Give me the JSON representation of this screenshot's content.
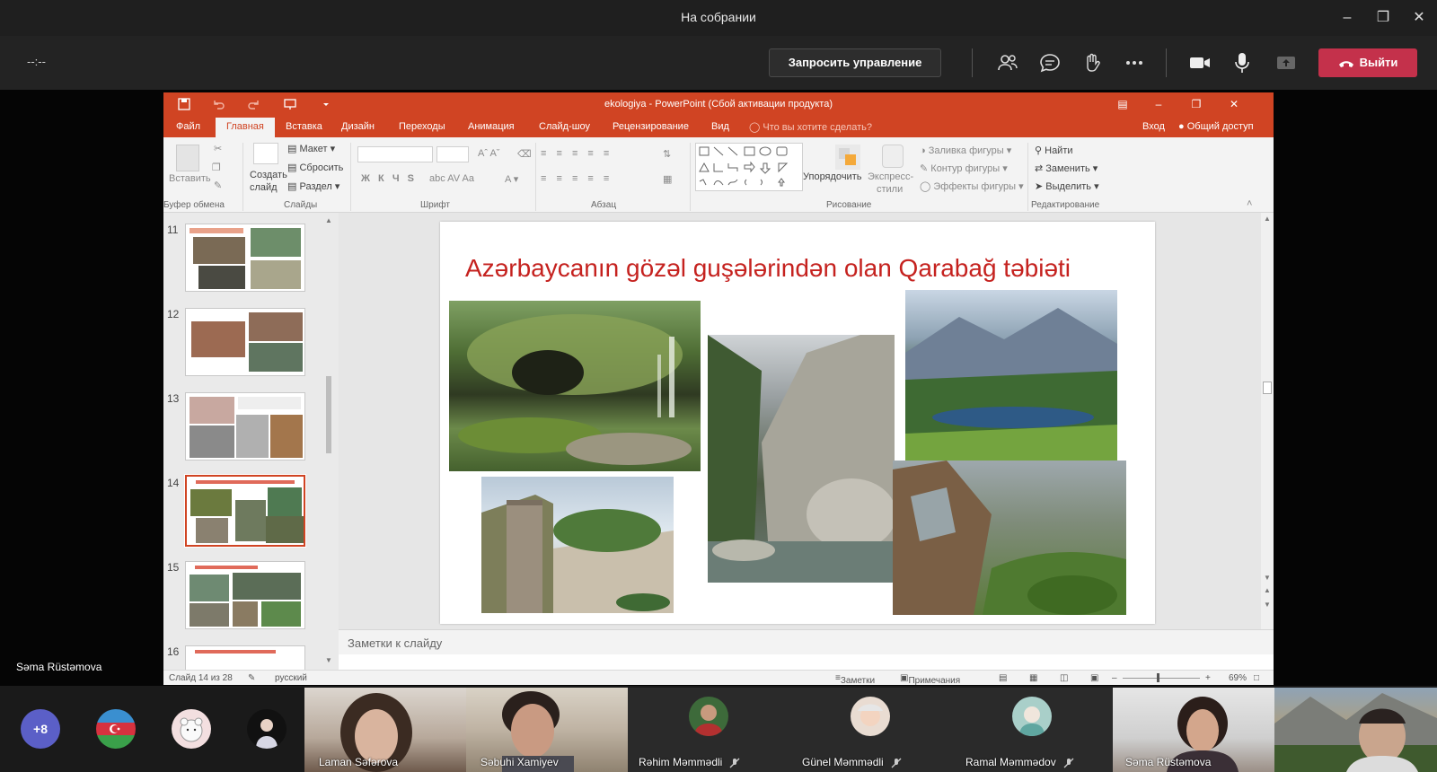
{
  "teams": {
    "window_title": "На собрании",
    "timer": "--:--",
    "request_control": "Запросить управление",
    "leave": "Выйти",
    "presenter_name": "Səma Rüstəmova"
  },
  "ppt": {
    "window_title": "ekologiya - PowerPoint (Сбой активации продукта)",
    "tabs": [
      "Файл",
      "Главная",
      "Вставка",
      "Дизайн",
      "Переходы",
      "Анимация",
      "Слайд-шоу",
      "Рецензирование",
      "Вид"
    ],
    "tell_me": "Что вы хотите сделать?",
    "sign_in": "Вход",
    "share": "Общий доступ",
    "ribbon": {
      "paste": "Вставить",
      "clipboard": "Буфер обмена",
      "new_slide_1": "Создать",
      "new_slide_2": "слайд",
      "layout": "Макет",
      "reset": "Сбросить",
      "section": "Раздел",
      "slides": "Слайды",
      "font": "Шрифт",
      "paragraph": "Абзац",
      "arrange": "Упорядочить",
      "quick_styles_1": "Экспресс-",
      "quick_styles_2": "стили",
      "shape_fill": "Заливка фигуры",
      "shape_outline": "Контур фигуры",
      "shape_effects": "Эффекты фигуры",
      "drawing": "Рисование",
      "find": "Найти",
      "replace": "Заменить",
      "select": "Выделить",
      "editing": "Редактирование"
    },
    "thumb_numbers": [
      "11",
      "12",
      "13",
      "14",
      "15",
      "16"
    ],
    "slide_title": "Azərbaycanın gözəl guşələrindən olan Qarabağ təbiəti",
    "notes_placeholder": "Заметки к слайду",
    "status": {
      "slide_info": "Слайд 14 из 28",
      "language": "русский",
      "notes": "Заметки",
      "comments": "Примечания",
      "zoom": "69%"
    }
  },
  "participants": {
    "more_count": "+8",
    "tiles": [
      {
        "name": "Laman Səfərova",
        "muted": false
      },
      {
        "name": "Səbuhi Xamiyev",
        "muted": false
      },
      {
        "name": "Rəhim Məmmədli",
        "muted": true
      },
      {
        "name": "Günel Məmmədli",
        "muted": true
      },
      {
        "name": "Ramal Məmmədov",
        "muted": true
      },
      {
        "name": "Səma Rüstəmova",
        "muted": false
      }
    ]
  },
  "colors": {
    "ppt_accent": "#d04423",
    "leave_red": "#c4314b",
    "title_red": "#c5221f"
  }
}
